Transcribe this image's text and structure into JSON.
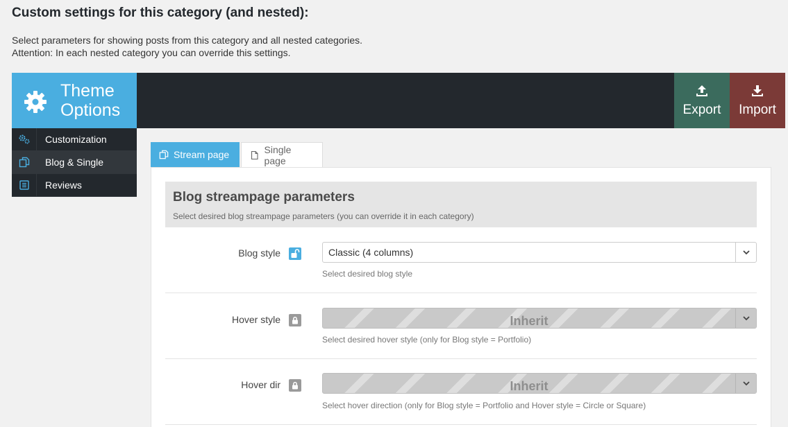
{
  "page": {
    "heading": "Custom settings for this category (and nested):",
    "desc_line1": "Select parameters for showing posts from this category and all nested categories.",
    "desc_line2": "Attention: In each nested category you can override this settings."
  },
  "header": {
    "logo_line1": "Theme",
    "logo_line2": "Options",
    "export_label": "Export",
    "import_label": "Import",
    "colors": {
      "logo_bg": "#4aaee0",
      "bar_bg": "#23282d",
      "export_bg": "#3b6b5d",
      "import_bg": "#7b3a37"
    }
  },
  "sidebar": {
    "items": [
      {
        "label": "Customization",
        "icon": "gears-icon",
        "active": false
      },
      {
        "label": "Blog & Single",
        "icon": "copy-icon",
        "active": true
      },
      {
        "label": "Reviews",
        "icon": "list-icon",
        "active": false
      }
    ]
  },
  "tabs": [
    {
      "label": "Stream page",
      "icon": "copy-icon",
      "active": true
    },
    {
      "label": "Single page",
      "icon": "file-icon",
      "active": false
    }
  ],
  "section": {
    "title": "Blog streampage parameters",
    "subtitle": "Select desired blog streampage parameters (you can override it in each category)"
  },
  "fields": [
    {
      "label": "Blog style",
      "value": "Classic (4 columns)",
      "hint": "Select desired blog style",
      "locked": false
    },
    {
      "label": "Hover style",
      "value": "Inherit",
      "hint": "Select desired hover style (only for Blog style = Portfolio)",
      "locked": true
    },
    {
      "label": "Hover dir",
      "value": "Inherit",
      "hint": "Select hover direction (only for Blog style = Portfolio and Hover style = Circle or Square)",
      "locked": true
    }
  ]
}
